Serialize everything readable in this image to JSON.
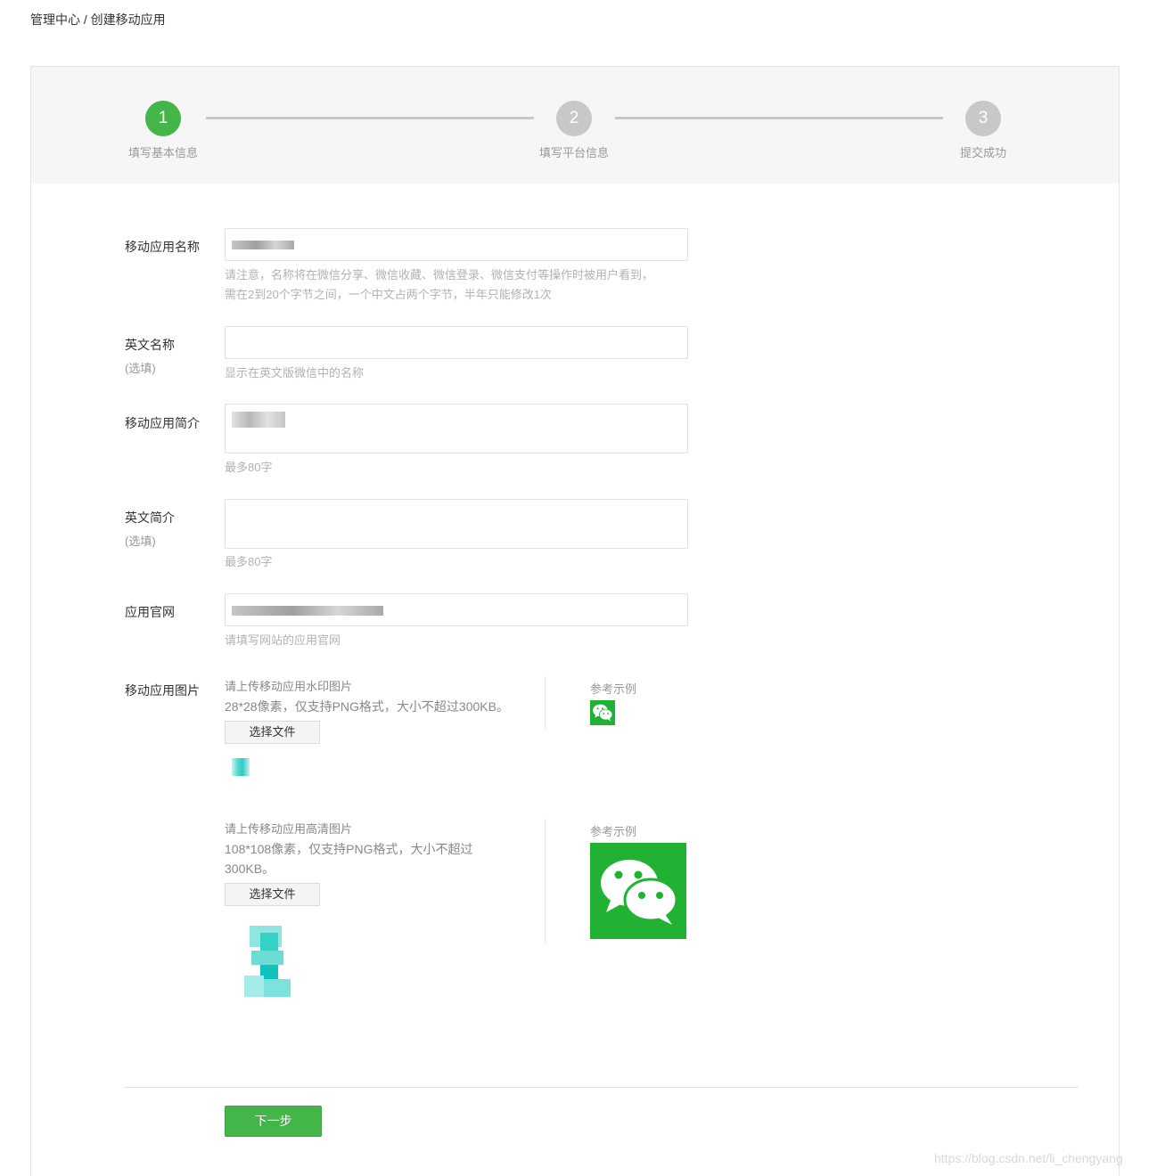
{
  "breadcrumb": "管理中心 / 创建移动应用",
  "steps": [
    {
      "number": "1",
      "label": "填写基本信息",
      "active": true
    },
    {
      "number": "2",
      "label": "填写平台信息",
      "active": false
    },
    {
      "number": "3",
      "label": "提交成功",
      "active": false
    }
  ],
  "form": {
    "app_name": {
      "label": "移动应用名称",
      "hint_line1": "请注意，名称将在微信分享、微信收藏、微信登录、微信支付等操作时被用户看到，",
      "hint_line2": "需在2到20个字节之间，一个中文占两个字节，半年只能修改1次"
    },
    "english_name": {
      "label": "英文名称",
      "optional": "(选填)",
      "hint": "显示在英文版微信中的名称"
    },
    "app_intro": {
      "label": "移动应用简介",
      "hint": "最多80字"
    },
    "english_intro": {
      "label": "英文简介",
      "optional": "(选填)",
      "hint": "最多80字"
    },
    "website": {
      "label": "应用官网",
      "hint": "请填写网站的应用官网"
    },
    "images": {
      "label": "移动应用图片",
      "watermark_title": "请上传移动应用水印图片",
      "watermark_spec": "28*28像素，仅支持PNG格式，大小不超过300KB。",
      "hd_title": "请上传移动应用高清图片",
      "hd_spec_line1": "108*108像素，仅支持PNG格式，大小不超过",
      "hd_spec_line2": "300KB。",
      "choose_file": "选择文件",
      "reference": "参考示例"
    }
  },
  "next_button": "下一步",
  "watermark_text": "https://blog.csdn.net/li_chengyang",
  "colors": {
    "accent": "#44b549",
    "wechat_green": "#21b233",
    "step_inactive": "#c8c8c8"
  },
  "icons": {
    "reference_icon": "wechat-logo-icon"
  }
}
